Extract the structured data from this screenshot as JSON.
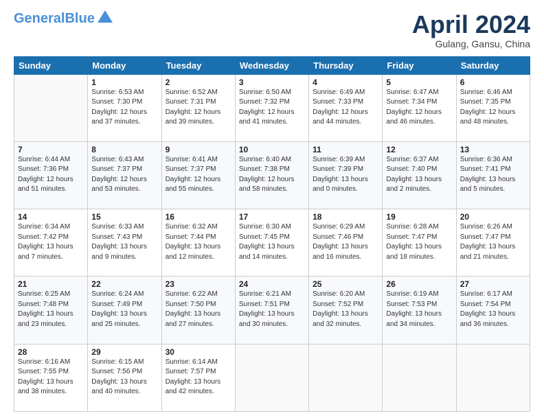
{
  "header": {
    "logo_line1": "General",
    "logo_line2": "Blue",
    "month": "April 2024",
    "location": "Gulang, Gansu, China"
  },
  "days_of_week": [
    "Sunday",
    "Monday",
    "Tuesday",
    "Wednesday",
    "Thursday",
    "Friday",
    "Saturday"
  ],
  "weeks": [
    [
      {
        "num": "",
        "info": ""
      },
      {
        "num": "1",
        "info": "Sunrise: 6:53 AM\nSunset: 7:30 PM\nDaylight: 12 hours\nand 37 minutes."
      },
      {
        "num": "2",
        "info": "Sunrise: 6:52 AM\nSunset: 7:31 PM\nDaylight: 12 hours\nand 39 minutes."
      },
      {
        "num": "3",
        "info": "Sunrise: 6:50 AM\nSunset: 7:32 PM\nDaylight: 12 hours\nand 41 minutes."
      },
      {
        "num": "4",
        "info": "Sunrise: 6:49 AM\nSunset: 7:33 PM\nDaylight: 12 hours\nand 44 minutes."
      },
      {
        "num": "5",
        "info": "Sunrise: 6:47 AM\nSunset: 7:34 PM\nDaylight: 12 hours\nand 46 minutes."
      },
      {
        "num": "6",
        "info": "Sunrise: 6:46 AM\nSunset: 7:35 PM\nDaylight: 12 hours\nand 48 minutes."
      }
    ],
    [
      {
        "num": "7",
        "info": "Sunrise: 6:44 AM\nSunset: 7:36 PM\nDaylight: 12 hours\nand 51 minutes."
      },
      {
        "num": "8",
        "info": "Sunrise: 6:43 AM\nSunset: 7:37 PM\nDaylight: 12 hours\nand 53 minutes."
      },
      {
        "num": "9",
        "info": "Sunrise: 6:41 AM\nSunset: 7:37 PM\nDaylight: 12 hours\nand 55 minutes."
      },
      {
        "num": "10",
        "info": "Sunrise: 6:40 AM\nSunset: 7:38 PM\nDaylight: 12 hours\nand 58 minutes."
      },
      {
        "num": "11",
        "info": "Sunrise: 6:39 AM\nSunset: 7:39 PM\nDaylight: 13 hours\nand 0 minutes."
      },
      {
        "num": "12",
        "info": "Sunrise: 6:37 AM\nSunset: 7:40 PM\nDaylight: 13 hours\nand 2 minutes."
      },
      {
        "num": "13",
        "info": "Sunrise: 6:36 AM\nSunset: 7:41 PM\nDaylight: 13 hours\nand 5 minutes."
      }
    ],
    [
      {
        "num": "14",
        "info": "Sunrise: 6:34 AM\nSunset: 7:42 PM\nDaylight: 13 hours\nand 7 minutes."
      },
      {
        "num": "15",
        "info": "Sunrise: 6:33 AM\nSunset: 7:43 PM\nDaylight: 13 hours\nand 9 minutes."
      },
      {
        "num": "16",
        "info": "Sunrise: 6:32 AM\nSunset: 7:44 PM\nDaylight: 13 hours\nand 12 minutes."
      },
      {
        "num": "17",
        "info": "Sunrise: 6:30 AM\nSunset: 7:45 PM\nDaylight: 13 hours\nand 14 minutes."
      },
      {
        "num": "18",
        "info": "Sunrise: 6:29 AM\nSunset: 7:46 PM\nDaylight: 13 hours\nand 16 minutes."
      },
      {
        "num": "19",
        "info": "Sunrise: 6:28 AM\nSunset: 7:47 PM\nDaylight: 13 hours\nand 18 minutes."
      },
      {
        "num": "20",
        "info": "Sunrise: 6:26 AM\nSunset: 7:47 PM\nDaylight: 13 hours\nand 21 minutes."
      }
    ],
    [
      {
        "num": "21",
        "info": "Sunrise: 6:25 AM\nSunset: 7:48 PM\nDaylight: 13 hours\nand 23 minutes."
      },
      {
        "num": "22",
        "info": "Sunrise: 6:24 AM\nSunset: 7:49 PM\nDaylight: 13 hours\nand 25 minutes."
      },
      {
        "num": "23",
        "info": "Sunrise: 6:22 AM\nSunset: 7:50 PM\nDaylight: 13 hours\nand 27 minutes."
      },
      {
        "num": "24",
        "info": "Sunrise: 6:21 AM\nSunset: 7:51 PM\nDaylight: 13 hours\nand 30 minutes."
      },
      {
        "num": "25",
        "info": "Sunrise: 6:20 AM\nSunset: 7:52 PM\nDaylight: 13 hours\nand 32 minutes."
      },
      {
        "num": "26",
        "info": "Sunrise: 6:19 AM\nSunset: 7:53 PM\nDaylight: 13 hours\nand 34 minutes."
      },
      {
        "num": "27",
        "info": "Sunrise: 6:17 AM\nSunset: 7:54 PM\nDaylight: 13 hours\nand 36 minutes."
      }
    ],
    [
      {
        "num": "28",
        "info": "Sunrise: 6:16 AM\nSunset: 7:55 PM\nDaylight: 13 hours\nand 38 minutes."
      },
      {
        "num": "29",
        "info": "Sunrise: 6:15 AM\nSunset: 7:56 PM\nDaylight: 13 hours\nand 40 minutes."
      },
      {
        "num": "30",
        "info": "Sunrise: 6:14 AM\nSunset: 7:57 PM\nDaylight: 13 hours\nand 42 minutes."
      },
      {
        "num": "",
        "info": ""
      },
      {
        "num": "",
        "info": ""
      },
      {
        "num": "",
        "info": ""
      },
      {
        "num": "",
        "info": ""
      }
    ]
  ]
}
